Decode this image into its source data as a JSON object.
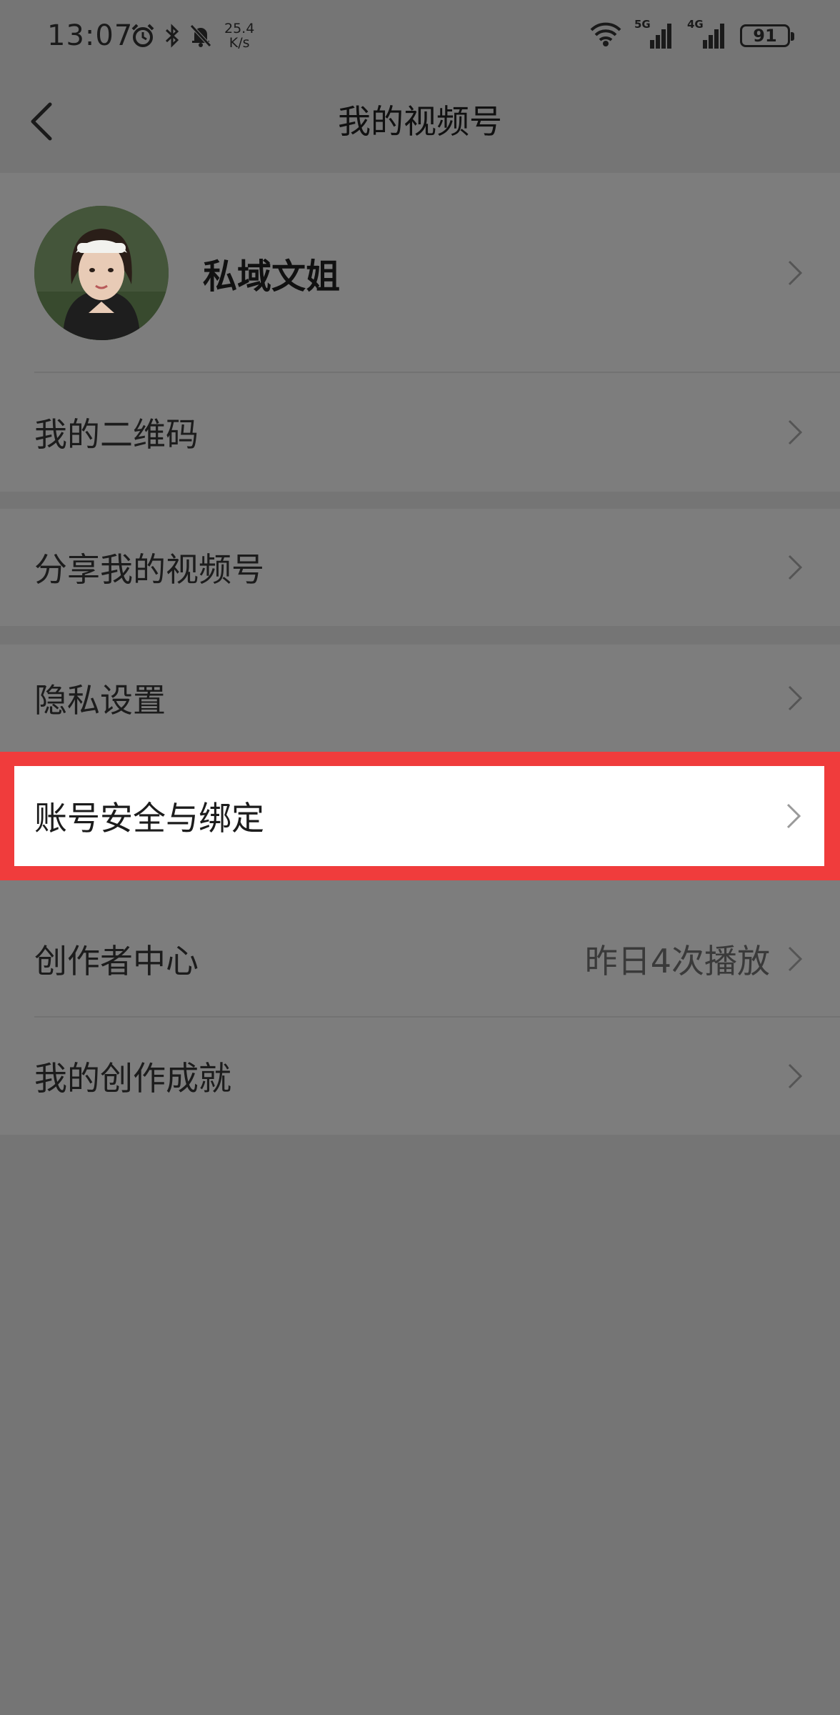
{
  "status_bar": {
    "time": "13:07",
    "net_speed_value": "25.4",
    "net_speed_unit": "K/s",
    "signal1_tag": "5G",
    "signal2_tag": "4G",
    "battery": "91",
    "icons": [
      "alarm-icon",
      "bluetooth-icon",
      "mute-bell-icon",
      "wifi-icon",
      "signal-icon",
      "battery-icon"
    ]
  },
  "nav": {
    "title": "我的视频号",
    "back_icon": "chevron-left-icon"
  },
  "profile": {
    "name": "私域文姐"
  },
  "menu": {
    "qr_code": "我的二维码",
    "share": "分享我的视频号",
    "privacy": "隐私设置",
    "account_security": "账号安全与绑定",
    "creator_center": "创作者中心",
    "creator_center_value": "昨日4次播放",
    "achievements": "我的创作成就"
  },
  "colors": {
    "overlay_background": "#757575",
    "card_background": "#7d7d7d",
    "highlight_border": "#f03c3c",
    "highlight_background": "#ffffff"
  }
}
